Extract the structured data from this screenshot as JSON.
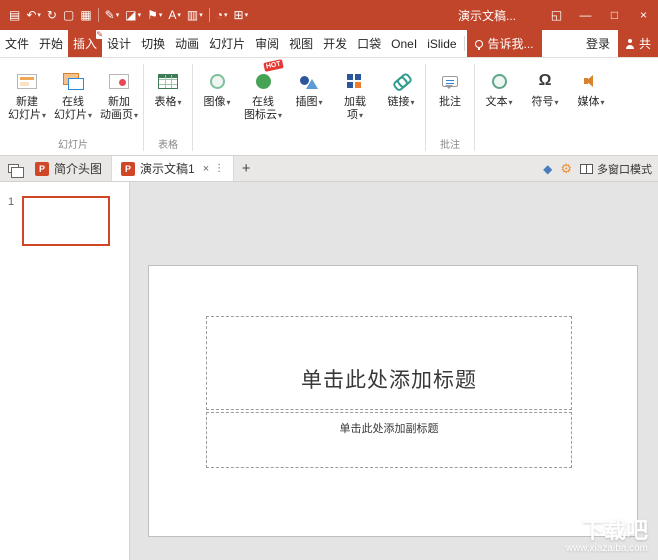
{
  "colors": {
    "accent": "#C0452A",
    "thumbnail_border": "#D04727",
    "hot_badge": "#E53935",
    "canvas_bg": "#E4E4E4"
  },
  "icons": {
    "caret": "▾",
    "close": "×",
    "minimize": "—",
    "maximize": "□",
    "window": "◱",
    "plus": "+",
    "more": "⋮",
    "pencil": "✎",
    "omega": "Ω",
    "gear": "⚙",
    "brush": "◆",
    "p_badge": "P"
  },
  "titlebar": {
    "title": "演示文稿...",
    "qat": [
      {
        "name": "save",
        "glyph": "▤"
      },
      {
        "name": "undo",
        "glyph": "↶"
      },
      {
        "name": "redo",
        "glyph": "↻"
      },
      {
        "name": "new-document",
        "glyph": "▢"
      },
      {
        "name": "keyboard",
        "glyph": "▦"
      },
      {
        "name": "pen",
        "glyph": "✎"
      },
      {
        "name": "format-painter",
        "glyph": "◪"
      },
      {
        "name": "flag",
        "glyph": "⚑"
      },
      {
        "name": "font-color",
        "glyph": "A"
      },
      {
        "name": "paste",
        "glyph": "▥"
      },
      {
        "name": "shapes",
        "glyph": "◔"
      },
      {
        "name": "grid",
        "glyph": "⊞"
      }
    ]
  },
  "tabs": [
    {
      "label": "文件"
    },
    {
      "label": "开始"
    },
    {
      "label": "插入"
    },
    {
      "label": "设计"
    },
    {
      "label": "切换"
    },
    {
      "label": "动画"
    },
    {
      "label": "幻灯片"
    },
    {
      "label": "审阅"
    },
    {
      "label": "视图"
    },
    {
      "label": "开发"
    },
    {
      "label": "口袋"
    },
    {
      "label": "OneI"
    },
    {
      "label": "iSlide"
    }
  ],
  "tab_extras": {
    "tellme": "告诉我...",
    "signin": "登录",
    "share": "共"
  },
  "ribbon": {
    "hot_badge": "HOT",
    "groups": [
      {
        "label": "幻灯片",
        "buttons": [
          {
            "label": "新建\n幻灯片"
          },
          {
            "label": "在线\n幻灯片"
          },
          {
            "label": "新加\n动画页"
          }
        ]
      },
      {
        "label": "表格",
        "buttons": [
          {
            "label": "表格"
          }
        ]
      },
      {
        "label": "",
        "buttons": [
          {
            "label": "图像"
          },
          {
            "label": "在线\n图标云"
          },
          {
            "label": "插图"
          },
          {
            "label": "加载\n项"
          },
          {
            "label": "链接"
          }
        ]
      },
      {
        "label": "批注",
        "buttons": [
          {
            "label": "批注"
          }
        ]
      },
      {
        "label": "",
        "buttons": [
          {
            "label": "文本"
          },
          {
            "label": "符号"
          },
          {
            "label": "媒体"
          }
        ]
      }
    ]
  },
  "doctabs": {
    "tabs": [
      {
        "title": "简介头图"
      },
      {
        "title": "演示文稿1"
      }
    ],
    "multiwindow": "多窗口模式"
  },
  "slides_panel": {
    "slide_number": "1"
  },
  "slide": {
    "title_placeholder": "单击此处添加标题",
    "subtitle_placeholder": "单击此处添加副标题"
  },
  "watermark": {
    "name": "下载吧",
    "site": "www.xiazaiba.com"
  }
}
